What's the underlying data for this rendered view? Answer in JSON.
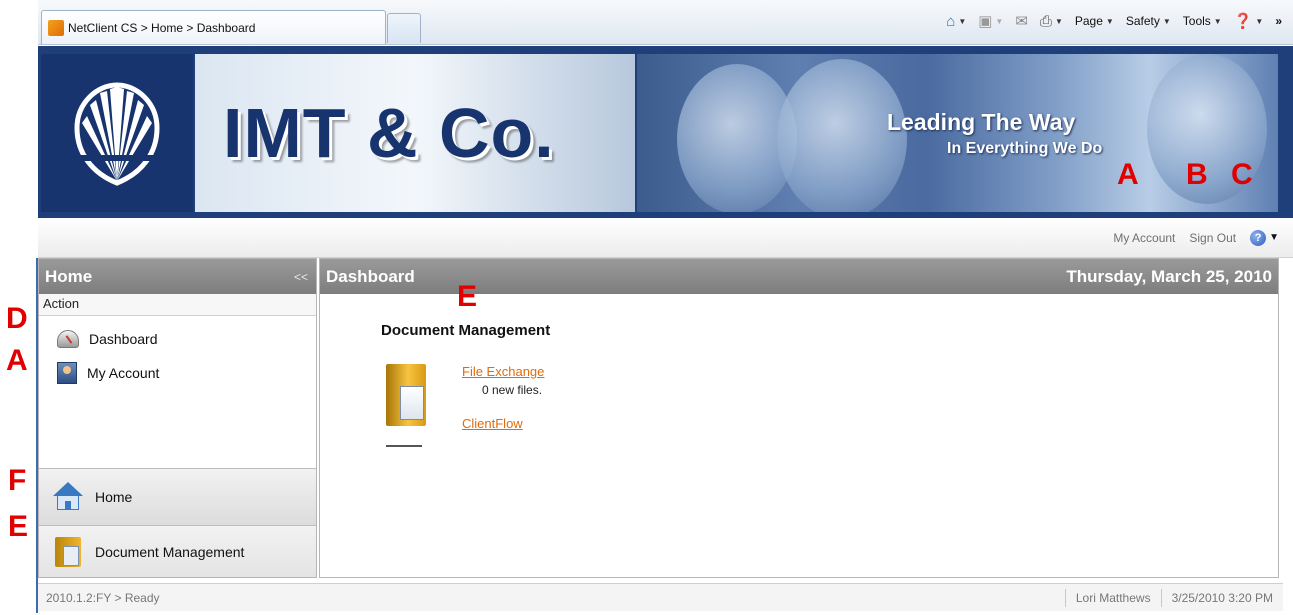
{
  "browser": {
    "tab_title": "NetClient CS > Home > Dashboard",
    "commands": [
      "Page",
      "Safety",
      "Tools"
    ],
    "overflow": "»"
  },
  "banner": {
    "brand": "IMT & Co.",
    "tagline_1": "Leading The Way",
    "tagline_2": "In Everything We Do"
  },
  "subheader": {
    "my_account": "My Account",
    "sign_out": "Sign Out"
  },
  "left_panel": {
    "title": "Home",
    "collapse": "<<",
    "section_label": "Action",
    "items": [
      {
        "label": "Dashboard",
        "icon": "dashboard-gauge-icon"
      },
      {
        "label": "My Account",
        "icon": "account-icon"
      }
    ],
    "nav": [
      {
        "label": "Home",
        "icon": "house-icon"
      },
      {
        "label": "Document Management",
        "icon": "document-icon"
      }
    ]
  },
  "main": {
    "title": "Dashboard",
    "date": "Thursday, March 25, 2010",
    "section_title": "Document Management",
    "links": [
      {
        "label": "File Exchange",
        "detail": "0 new files."
      },
      {
        "label": "ClientFlow"
      }
    ]
  },
  "status": {
    "left": "2010.1.2:FY > Ready",
    "user": "Lori Matthews",
    "datetime": "3/25/2010 3:20 PM"
  },
  "annotations": {
    "banner_a": "A",
    "banner_b": "B",
    "banner_c": "C",
    "main_e": "E",
    "left_d": "D",
    "left_a": "A",
    "left_f": "F",
    "left_e": "E"
  },
  "colors": {
    "accent": "#e06b0b",
    "header_gray": "#8c8c8c",
    "brand_navy": "#17346e",
    "annotation_red": "#e00000"
  }
}
